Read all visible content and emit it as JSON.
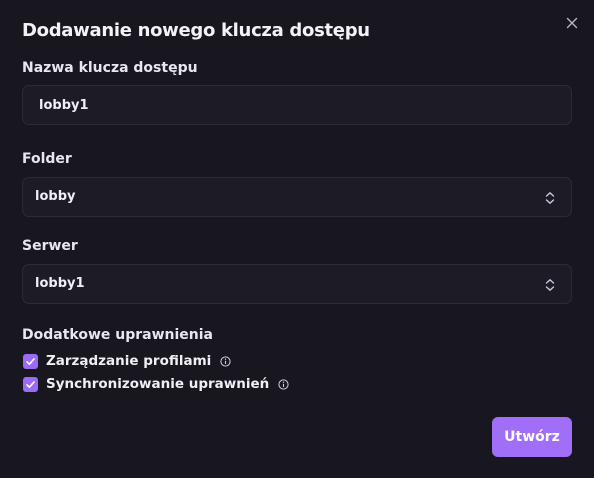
{
  "dialog": {
    "title": "Dodawanie nowego klucza dostępu"
  },
  "fields": {
    "key_name": {
      "label": "Nazwa klucza dostępu",
      "value": "lobby1"
    },
    "folder": {
      "label": "Folder",
      "value": "lobby"
    },
    "server": {
      "label": "Serwer",
      "value": "lobby1"
    }
  },
  "permissions": {
    "label": "Dodatkowe uprawnienia",
    "items": [
      {
        "label": "Zarządzanie profilami",
        "checked": true
      },
      {
        "label": "Synchronizowanie uprawnień",
        "checked": true
      }
    ]
  },
  "actions": {
    "submit_label": "Utwórz"
  },
  "colors": {
    "background": "#18161f",
    "field_background": "#1d1b25",
    "field_border": "#2e2b38",
    "accent": "#a06ef7"
  },
  "icons": {
    "close": "close-icon",
    "select": "chevron-up-down-icon",
    "check": "checkmark-icon",
    "info": "info-icon"
  }
}
